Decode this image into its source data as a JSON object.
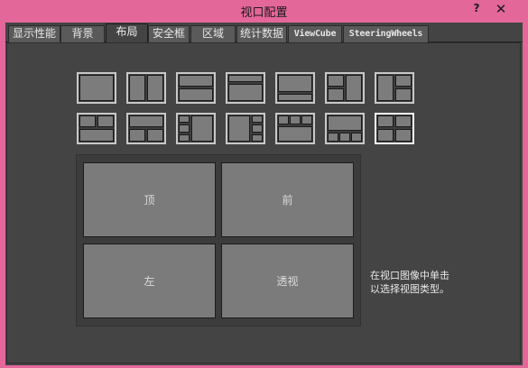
{
  "window": {
    "title": "视口配置",
    "help": "?",
    "close": "✕"
  },
  "tabs": [
    {
      "label": "显示性能",
      "active": false
    },
    {
      "label": "背景",
      "active": false
    },
    {
      "label": "布局",
      "active": true
    },
    {
      "label": "安全框",
      "active": false
    },
    {
      "label": "区域",
      "active": false
    },
    {
      "label": "统计数据",
      "active": false
    },
    {
      "label": "ViewCube",
      "active": false
    },
    {
      "label": "SteeringWheels",
      "active": false
    }
  ],
  "viewports": {
    "top_left": "顶",
    "top_right": "前",
    "bottom_left": "左",
    "bottom_right": "透视"
  },
  "hint": {
    "line1": "在视口图像中单击",
    "line2": "以选择视图类型。"
  }
}
